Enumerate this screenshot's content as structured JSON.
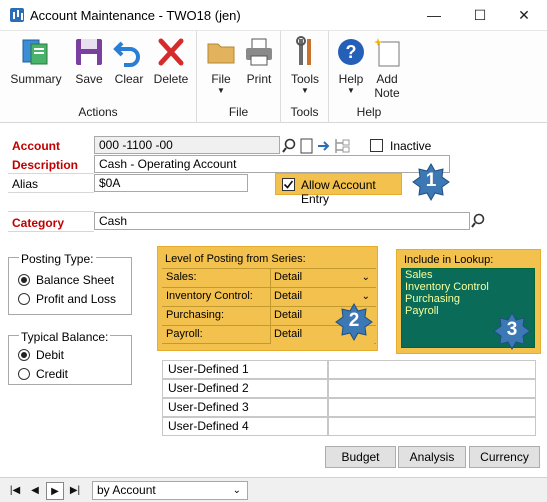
{
  "window": {
    "title": "Account Maintenance  -  TWO18 (jen)",
    "minimize": "—",
    "maximize": "☐",
    "close": "✕"
  },
  "ribbon": {
    "groups": [
      {
        "label": "Actions",
        "buttons": [
          "Summary",
          "Save",
          "Clear",
          "Delete"
        ]
      },
      {
        "label": "File",
        "buttons": [
          "File",
          "Print"
        ]
      },
      {
        "label": "Tools",
        "buttons": [
          "Tools"
        ]
      },
      {
        "label": "Help",
        "buttons": [
          "Help",
          "Add\nNote"
        ]
      }
    ],
    "add_note_line1": "Add",
    "add_note_line2": "Note"
  },
  "form": {
    "account_label": "Account",
    "account_value": "000 -1100 -00",
    "inactive_label": "Inactive",
    "description_label": "Description",
    "description_value": "Cash - Operating Account",
    "alias_label": "Alias",
    "alias_value": "$0A",
    "allow_entry_label": "Allow Account Entry",
    "allow_entry_checked": true,
    "category_label": "Category",
    "category_value": "Cash"
  },
  "callouts": [
    "1",
    "2",
    "3"
  ],
  "posting_type": {
    "title": "Posting Type:",
    "options": [
      "Balance Sheet",
      "Profit and Loss"
    ],
    "selected": "Balance Sheet"
  },
  "typical_balance": {
    "title": "Typical Balance:",
    "options": [
      "Debit",
      "Credit"
    ],
    "selected": "Debit"
  },
  "level_posting": {
    "title": "Level of Posting from Series:",
    "rows": [
      {
        "label": "Sales:",
        "value": "Detail"
      },
      {
        "label": "Inventory Control:",
        "value": "Detail"
      },
      {
        "label": "Purchasing:",
        "value": "Detail"
      },
      {
        "label": "Payroll:",
        "value": "Detail"
      }
    ]
  },
  "lookup": {
    "title": "Include in Lookup:",
    "items": [
      "Sales",
      "Inventory Control",
      "Purchasing",
      "Payroll"
    ]
  },
  "user_defined": [
    "User-Defined 1",
    "User-Defined 2",
    "User-Defined 3",
    "User-Defined 4"
  ],
  "buttons": {
    "budget": "Budget",
    "analysis": "Analysis",
    "currency": "Currency"
  },
  "footer": {
    "sort_value": "by Account"
  },
  "colors": {
    "highlight": "#f2c14e",
    "lookup_bg": "#0b6b59",
    "required_label": "#c00000",
    "callout": "#3c78b4"
  }
}
